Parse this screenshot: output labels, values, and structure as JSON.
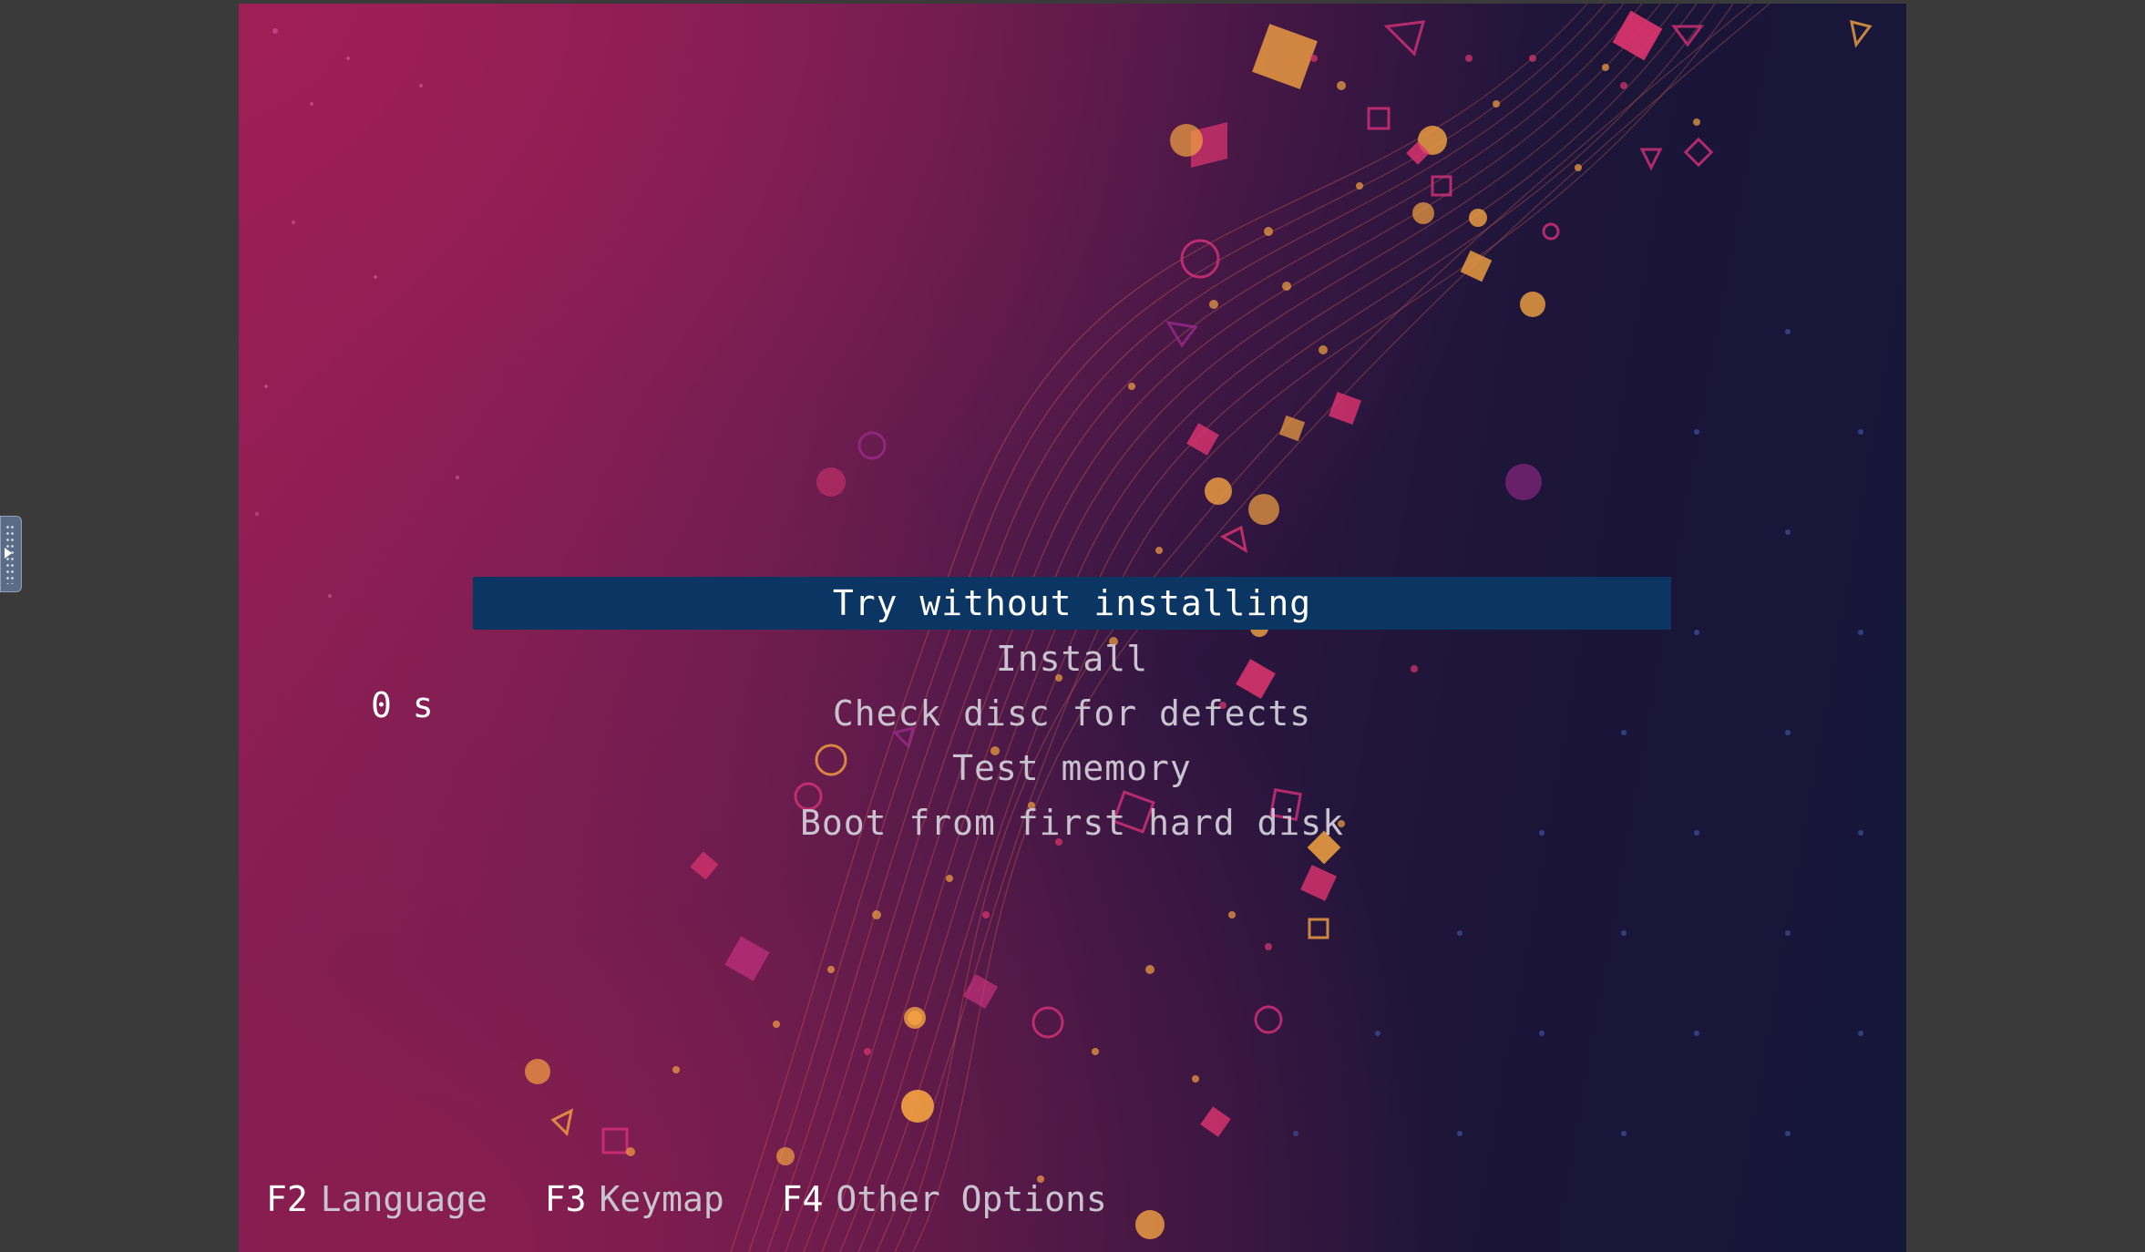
{
  "boot_menu": {
    "items": [
      {
        "label": "Try without installing",
        "selected": true
      },
      {
        "label": "Install",
        "selected": false
      },
      {
        "label": "Check disc for defects",
        "selected": false
      },
      {
        "label": "Test memory",
        "selected": false
      },
      {
        "label": "Boot from first hard disk",
        "selected": false
      }
    ],
    "countdown": "0 s"
  },
  "function_keys": [
    {
      "key": "F2",
      "label": "Language"
    },
    {
      "key": "F3",
      "label": "Keymap"
    },
    {
      "key": "F4",
      "label": "Other Options"
    }
  ],
  "colors": {
    "selection_bar": "#0b3563",
    "selected_text": "#ffffff",
    "menu_text": "#c9c2cf",
    "accent_orange": "#f4a341",
    "accent_magenta": "#d8317a"
  },
  "icons": {
    "side_handle": "expand-panel-icon"
  }
}
